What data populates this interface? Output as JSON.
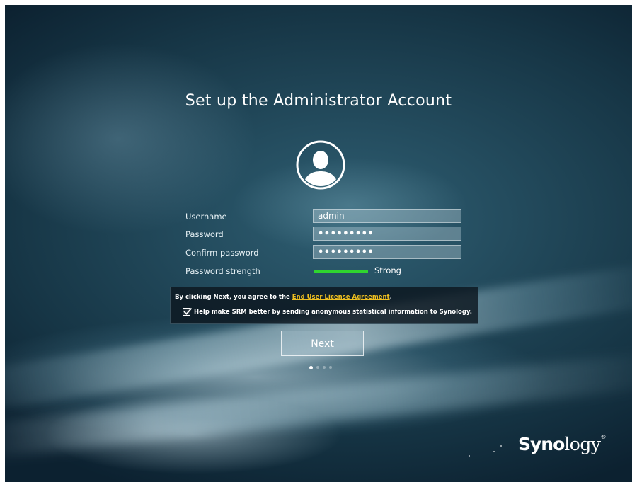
{
  "page": {
    "title": "Set up the Administrator Account"
  },
  "avatar": {
    "icon": "user-avatar-icon"
  },
  "form": {
    "username": {
      "label": "Username",
      "value": "admin"
    },
    "password": {
      "label": "Password",
      "value": "•••••••••"
    },
    "confirm_password": {
      "label": "Confirm password",
      "value": "•••••••••"
    },
    "strength": {
      "label": "Password strength",
      "value": "Strong",
      "color": "#2fd52f"
    }
  },
  "agreement": {
    "text_prefix": "By clicking Next, you agree to the ",
    "link_text": "End User License Agreement",
    "text_suffix": ".",
    "checkbox_label": "Help make SRM better by sending anonymous statistical information to Synology.",
    "checkbox_checked": true
  },
  "next_button": {
    "label": "Next"
  },
  "pager": {
    "pages": 4,
    "active": 1
  },
  "brand": {
    "logo_bold": "Syno",
    "logo_rest": "logy",
    "mark": "®"
  },
  "colors": {
    "link": "#f0c020",
    "background": "#1c4050"
  }
}
